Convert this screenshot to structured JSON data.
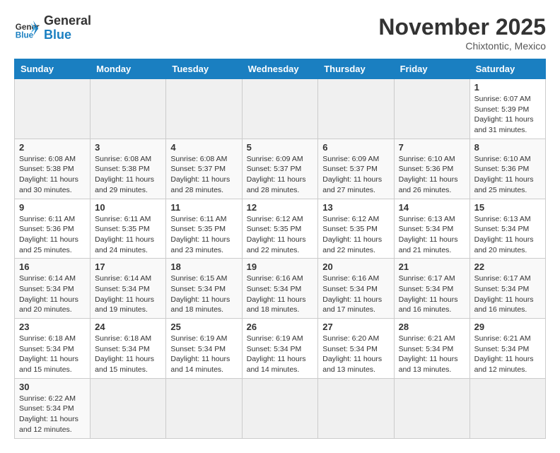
{
  "header": {
    "logo_general": "General",
    "logo_blue": "Blue",
    "month_title": "November 2025",
    "location": "Chixtontic, Mexico"
  },
  "days_of_week": [
    "Sunday",
    "Monday",
    "Tuesday",
    "Wednesday",
    "Thursday",
    "Friday",
    "Saturday"
  ],
  "weeks": [
    [
      {
        "day": "",
        "info": ""
      },
      {
        "day": "",
        "info": ""
      },
      {
        "day": "",
        "info": ""
      },
      {
        "day": "",
        "info": ""
      },
      {
        "day": "",
        "info": ""
      },
      {
        "day": "",
        "info": ""
      },
      {
        "day": "1",
        "info": "Sunrise: 6:07 AM\nSunset: 5:39 PM\nDaylight: 11 hours\nand 31 minutes."
      }
    ],
    [
      {
        "day": "2",
        "info": "Sunrise: 6:08 AM\nSunset: 5:38 PM\nDaylight: 11 hours\nand 30 minutes."
      },
      {
        "day": "3",
        "info": "Sunrise: 6:08 AM\nSunset: 5:38 PM\nDaylight: 11 hours\nand 29 minutes."
      },
      {
        "day": "4",
        "info": "Sunrise: 6:08 AM\nSunset: 5:37 PM\nDaylight: 11 hours\nand 28 minutes."
      },
      {
        "day": "5",
        "info": "Sunrise: 6:09 AM\nSunset: 5:37 PM\nDaylight: 11 hours\nand 28 minutes."
      },
      {
        "day": "6",
        "info": "Sunrise: 6:09 AM\nSunset: 5:37 PM\nDaylight: 11 hours\nand 27 minutes."
      },
      {
        "day": "7",
        "info": "Sunrise: 6:10 AM\nSunset: 5:36 PM\nDaylight: 11 hours\nand 26 minutes."
      },
      {
        "day": "8",
        "info": "Sunrise: 6:10 AM\nSunset: 5:36 PM\nDaylight: 11 hours\nand 25 minutes."
      }
    ],
    [
      {
        "day": "9",
        "info": "Sunrise: 6:11 AM\nSunset: 5:36 PM\nDaylight: 11 hours\nand 25 minutes."
      },
      {
        "day": "10",
        "info": "Sunrise: 6:11 AM\nSunset: 5:35 PM\nDaylight: 11 hours\nand 24 minutes."
      },
      {
        "day": "11",
        "info": "Sunrise: 6:11 AM\nSunset: 5:35 PM\nDaylight: 11 hours\nand 23 minutes."
      },
      {
        "day": "12",
        "info": "Sunrise: 6:12 AM\nSunset: 5:35 PM\nDaylight: 11 hours\nand 22 minutes."
      },
      {
        "day": "13",
        "info": "Sunrise: 6:12 AM\nSunset: 5:35 PM\nDaylight: 11 hours\nand 22 minutes."
      },
      {
        "day": "14",
        "info": "Sunrise: 6:13 AM\nSunset: 5:34 PM\nDaylight: 11 hours\nand 21 minutes."
      },
      {
        "day": "15",
        "info": "Sunrise: 6:13 AM\nSunset: 5:34 PM\nDaylight: 11 hours\nand 20 minutes."
      }
    ],
    [
      {
        "day": "16",
        "info": "Sunrise: 6:14 AM\nSunset: 5:34 PM\nDaylight: 11 hours\nand 20 minutes."
      },
      {
        "day": "17",
        "info": "Sunrise: 6:14 AM\nSunset: 5:34 PM\nDaylight: 11 hours\nand 19 minutes."
      },
      {
        "day": "18",
        "info": "Sunrise: 6:15 AM\nSunset: 5:34 PM\nDaylight: 11 hours\nand 18 minutes."
      },
      {
        "day": "19",
        "info": "Sunrise: 6:16 AM\nSunset: 5:34 PM\nDaylight: 11 hours\nand 18 minutes."
      },
      {
        "day": "20",
        "info": "Sunrise: 6:16 AM\nSunset: 5:34 PM\nDaylight: 11 hours\nand 17 minutes."
      },
      {
        "day": "21",
        "info": "Sunrise: 6:17 AM\nSunset: 5:34 PM\nDaylight: 11 hours\nand 16 minutes."
      },
      {
        "day": "22",
        "info": "Sunrise: 6:17 AM\nSunset: 5:34 PM\nDaylight: 11 hours\nand 16 minutes."
      }
    ],
    [
      {
        "day": "23",
        "info": "Sunrise: 6:18 AM\nSunset: 5:34 PM\nDaylight: 11 hours\nand 15 minutes."
      },
      {
        "day": "24",
        "info": "Sunrise: 6:18 AM\nSunset: 5:34 PM\nDaylight: 11 hours\nand 15 minutes."
      },
      {
        "day": "25",
        "info": "Sunrise: 6:19 AM\nSunset: 5:34 PM\nDaylight: 11 hours\nand 14 minutes."
      },
      {
        "day": "26",
        "info": "Sunrise: 6:19 AM\nSunset: 5:34 PM\nDaylight: 11 hours\nand 14 minutes."
      },
      {
        "day": "27",
        "info": "Sunrise: 6:20 AM\nSunset: 5:34 PM\nDaylight: 11 hours\nand 13 minutes."
      },
      {
        "day": "28",
        "info": "Sunrise: 6:21 AM\nSunset: 5:34 PM\nDaylight: 11 hours\nand 13 minutes."
      },
      {
        "day": "29",
        "info": "Sunrise: 6:21 AM\nSunset: 5:34 PM\nDaylight: 11 hours\nand 12 minutes."
      }
    ],
    [
      {
        "day": "30",
        "info": "Sunrise: 6:22 AM\nSunset: 5:34 PM\nDaylight: 11 hours\nand 12 minutes."
      },
      {
        "day": "",
        "info": ""
      },
      {
        "day": "",
        "info": ""
      },
      {
        "day": "",
        "info": ""
      },
      {
        "day": "",
        "info": ""
      },
      {
        "day": "",
        "info": ""
      },
      {
        "day": "",
        "info": ""
      }
    ]
  ]
}
